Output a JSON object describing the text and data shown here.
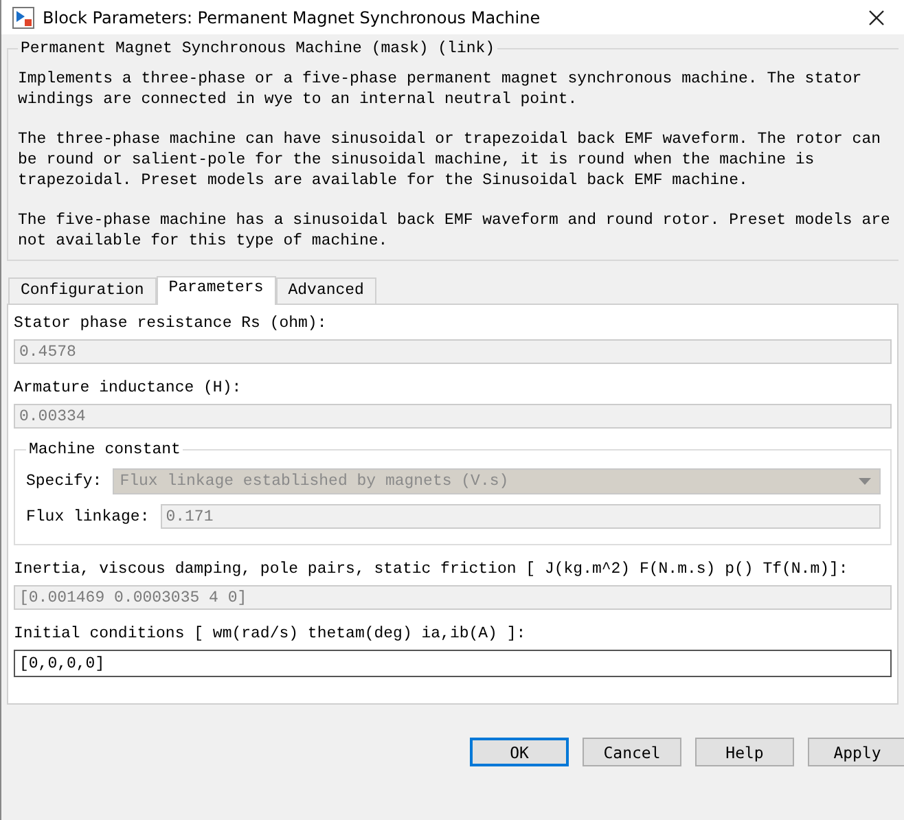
{
  "window": {
    "title": "Block Parameters: Permanent Magnet Synchronous Machine"
  },
  "description": {
    "title": "Permanent Magnet Synchronous Machine (mask) (link)",
    "paragraphs": [
      "Implements a three-phase or a five-phase permanent magnet synchronous machine. The stator windings are connected in wye to an internal neutral point.",
      "The three-phase machine can have sinusoidal or trapezoidal back EMF waveform. The rotor can be round or salient-pole for the sinusoidal machine, it is round when the machine is trapezoidal. Preset models are available for the Sinusoidal back EMF machine.",
      "The five-phase machine has a sinusoidal back EMF waveform and round rotor. Preset models are not available for this type of machine."
    ]
  },
  "tabs": [
    {
      "label": "Configuration",
      "selected": false
    },
    {
      "label": "Parameters",
      "selected": true
    },
    {
      "label": "Advanced",
      "selected": false
    }
  ],
  "parameters": [
    {
      "kind": "field",
      "label": "Stator phase resistance Rs (ohm):",
      "value": "0.4578",
      "disabled": true
    },
    {
      "kind": "field",
      "label": "Armature inductance (H):",
      "value": "0.00334",
      "disabled": true
    },
    {
      "kind": "group",
      "title": "Machine constant",
      "rows": [
        {
          "kind": "dropdown",
          "label": "Specify:",
          "value": "Flux linkage established by magnets (V.s)",
          "disabled": true
        },
        {
          "kind": "field",
          "label": "Flux linkage:",
          "value": "0.171",
          "disabled": true
        }
      ]
    },
    {
      "kind": "field",
      "label": "Inertia, viscous damping, pole pairs, static friction [ J(kg.m^2)  F(N.m.s)  p()  Tf(N.m)]:",
      "value": "[0.001469 0.0003035 4 0]",
      "disabled": true
    },
    {
      "kind": "field",
      "label": "Initial conditions  [ wm(rad/s)  thetam(deg)  ia,ib(A) ]:",
      "value": "[0,0,0,0]",
      "disabled": false
    }
  ],
  "buttons": [
    {
      "label": "OK",
      "selected": true
    },
    {
      "label": "Cancel",
      "selected": false
    },
    {
      "label": "Help",
      "selected": false
    },
    {
      "label": "Apply",
      "selected": false
    }
  ]
}
